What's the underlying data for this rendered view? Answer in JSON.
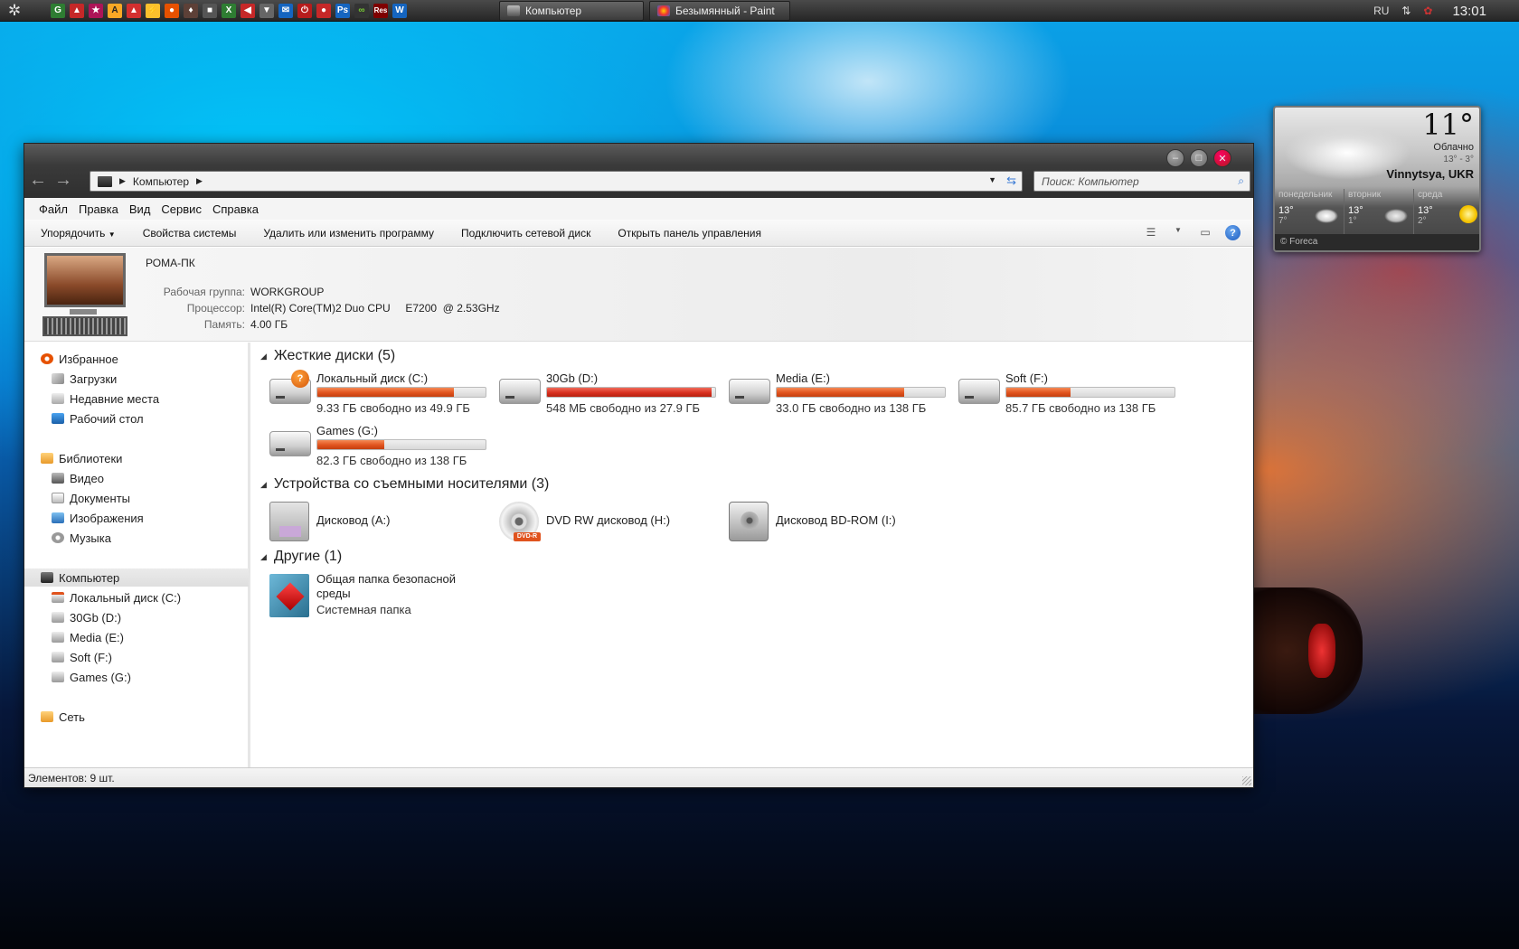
{
  "taskbar": {
    "tasks": [
      {
        "label": "Компьютер",
        "active": true
      },
      {
        "label": "Безымянный - Paint",
        "active": false
      }
    ],
    "lang": "RU",
    "clock": "13:01",
    "quick_launch_icons": [
      "app-icon-1",
      "app-icon-2",
      "app-icon-3",
      "app-icon-4",
      "app-icon-5",
      "app-icon-6",
      "app-icon-7",
      "app-icon-8",
      "app-icon-9",
      "app-icon-10",
      "app-icon-11",
      "app-icon-12",
      "app-icon-13",
      "app-icon-14",
      "app-icon-15",
      "app-icon-16",
      "app-icon-17",
      "app-icon-18",
      "app-icon-19"
    ],
    "quick_launch_labels": {
      "res": "Res",
      "w": "W",
      "ps": "Ps",
      "x": "X",
      "inf": "∞"
    }
  },
  "weather": {
    "temp": "11°",
    "condition": "Облачно",
    "range": "13° - 3°",
    "city": "Vinnytsya, UKR",
    "days": [
      {
        "name": "понедельник",
        "high": "13°",
        "low": "7°",
        "icon": "cloud-icon"
      },
      {
        "name": "вторник",
        "high": "13°",
        "low": "1°",
        "icon": "cloud-icon"
      },
      {
        "name": "среда",
        "high": "13°",
        "low": "2°",
        "icon": "sun-icon"
      }
    ],
    "footer": "© Foreca"
  },
  "window": {
    "address": {
      "path": "Компьютер"
    },
    "search": {
      "placeholder": "Поиск: Компьютер"
    },
    "menu": [
      "Файл",
      "Правка",
      "Вид",
      "Сервис",
      "Справка"
    ],
    "toolbar": {
      "organize": "Упорядочить",
      "system_props": "Свойства системы",
      "uninstall": "Удалить или изменить программу",
      "map_drive": "Подключить сетевой диск",
      "control_panel": "Открыть панель управления"
    },
    "info": {
      "pc_name": "РОМА-ПК",
      "workgroup_label": "Рабочая группа:",
      "workgroup": "WORKGROUP",
      "cpu_label": "Процессор:",
      "cpu": "Intel(R) Core(TM)2 Duo CPU     E7200  @ 2.53GHz",
      "ram_label": "Память:",
      "ram": "4.00 ГБ"
    },
    "sidebar": {
      "favorites": "Избранное",
      "downloads": "Загрузки",
      "recent": "Недавние места",
      "desktop": "Рабочий стол",
      "libraries": "Библиотеки",
      "video": "Видео",
      "documents": "Документы",
      "pictures": "Изображения",
      "music": "Музыка",
      "computer": "Компьютер",
      "drive_c": "Локальный диск (C:)",
      "drive_d": "30Gb (D:)",
      "drive_e": "Media (E:)",
      "drive_f": "Soft (F:)",
      "drive_g": "Games (G:)",
      "network": "Сеть"
    },
    "groups": {
      "hdd": "Жесткие диски (5)",
      "removable": "Устройства со съемными носителями (3)",
      "other": "Другие (1)"
    },
    "drives": [
      {
        "name": "Локальный диск (C:)",
        "free": "9.33 ГБ свободно из 49.9 ГБ",
        "used_fraction": 0.81
      },
      {
        "name": "30Gb (D:)",
        "free": "548 МБ свободно из 27.9 ГБ",
        "used_fraction": 0.98
      },
      {
        "name": "Media (E:)",
        "free": "33.0 ГБ свободно из 138 ГБ",
        "used_fraction": 0.76
      },
      {
        "name": "Soft (F:)",
        "free": "85.7 ГБ свободно из 138 ГБ",
        "used_fraction": 0.38
      },
      {
        "name": "Games (G:)",
        "free": "82.3 ГБ свободно из 138 ГБ",
        "used_fraction": 0.4
      }
    ],
    "devices": [
      {
        "name": "Дисковод (A:)",
        "icon": "floppy-icon"
      },
      {
        "name": "DVD RW дисковод (H:)",
        "icon": "dvd-icon",
        "badge": "DVD-R"
      },
      {
        "name": "Дисковод BD-ROM (I:)",
        "icon": "bd-icon"
      }
    ],
    "other": {
      "name": "Общая папка безопасной среды",
      "type": "Системная папка"
    },
    "status": "Элементов: 9 шт.",
    "colors": {
      "bar_fill": "#e0531e",
      "bar_full": "#d8301f"
    }
  }
}
